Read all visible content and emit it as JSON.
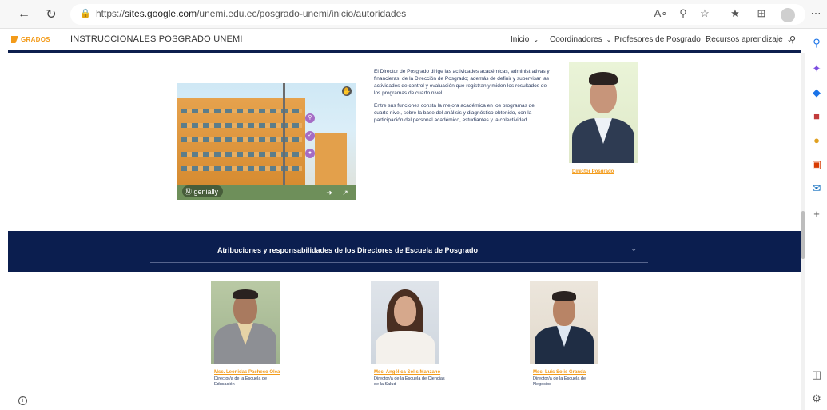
{
  "browser": {
    "url_prefix": "https://",
    "url_host": "sites.google.com",
    "url_path": "/unemi.edu.ec/posgrado-unemi/inicio/autoridades"
  },
  "site": {
    "logo_text": "GRADOS",
    "title": "INSTRUCCIONALES POSGRADO UNEMI",
    "nav": [
      {
        "label": "Inicio"
      },
      {
        "label": "Coordinadores"
      },
      {
        "label": "Profesores de Posgrado"
      },
      {
        "label": "Recursos aprendizaje"
      }
    ]
  },
  "director": {
    "paragraph1": "El Director de Posgrado dirige las actividades académicas, administrativas y financieras, de la Dirección de Posgrado; además de definir y supervisar las actividades de control y evaluación que registran y miden los resultados de los programas de cuarto nivel.",
    "paragraph2": "Entre sus funciones consta la mejora académica en los programas de cuarto nivel, sobre la base del análisis y diagnóstico obtenido, con la participación del personal académico, estudiantes y la colectividad.",
    "caption": "Director Posgrado"
  },
  "embed": {
    "brand": "genially"
  },
  "banner": {
    "title": "Atribuciones y responsabilidades de los Directores de Escuela de Posgrado"
  },
  "school_directors": [
    {
      "name": "Msc. Leonidas Pacheco Olea",
      "role": "Director/a de la Escuela de Educación"
    },
    {
      "name": "Msc. Angélica Solis Manzano",
      "role": "Director/a de la Escuela de Ciencias de la Salud"
    },
    {
      "name": "Msc. Luis Solis Granda",
      "role": "Director/a de la Escuela de Negocios"
    }
  ],
  "colors": {
    "brand_orange": "#f39b1a",
    "navy": "#0b1e4f"
  }
}
